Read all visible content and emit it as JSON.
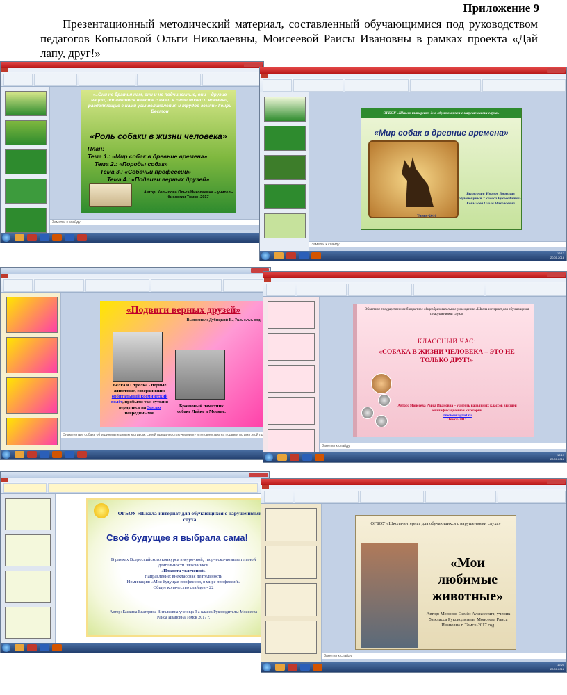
{
  "document": {
    "appendix": "Приложение 9",
    "intro": "Презентационный методический материал, составленный обучающимися под руководством педагогов Копыловой Ольги Николаевны, Моисеевой Раисы Ивановны в рамках проекта «Дай лапу, друг!»"
  },
  "screenshots": {
    "notes_label": "Заметки к слайду",
    "s1": {
      "epigraph": "«..Они не братья нам, они и не подчиненные, они – другие нации, попавшиеся вместе с нами в сети жизни и времени, разделяющие с нами узы великолепия и трудов земли» Генри Бестон",
      "title": "«Роль собаки в жизни человека»",
      "plan": [
        "План:",
        "Тема 1.: «Мир собак в древние времена»",
        "Тема 2.: «Породы собак»",
        "Тема 3.: «Собачьи профессии»",
        "Тема 4.: «Подвиги верных друзей»"
      ],
      "author": "Автор: Копылова Ольга Николаевна – учитель биологии Томск -2017"
    },
    "s2": {
      "org": "ОГБОУ «Школа-интернат для обучающихся с нарушениями слуха»",
      "title": "«Мир собак в древние времена»",
      "info": "Выполнил: Иванов Вячеслав обучающийся 7 класса Руководитель: Копылова Ольга Николаевна",
      "city": "Томск-2016"
    },
    "s3": {
      "title": "«Подвиги верных друзей»",
      "byline": "Выполнил: Дубицкий В., 7кл. о.ч.з. отд.",
      "caption1_a": "Белка и Стрелка - первые животные, совершившие",
      "caption1_link": "орбитальный космический полёт",
      "caption1_b": ", пробыли там сутки и вернулись на",
      "caption1_link2": "Землю",
      "caption1_c": "невредимыми.",
      "caption2": "Бронзовый памятник собаке Лайке в Москве.",
      "notes": "Знаменитые собаки объединены единым мотивом: своей преданностью человеку и готовностью на подвиги во имя этой преданности"
    },
    "s4": {
      "org": "Областное государственное бюджетное общеобразовательное учреждение «Школа-интернат для обучающихся с нарушениями слуха»",
      "subtitle": "КЛАССНЫЙ ЧАС:",
      "title": "«СОБАКА В ЖИЗНИ ЧЕЛОВЕКА – ЭТО НЕ ТОЛЬКО ДРУГ!»",
      "author": "Автор: Моисеева Раиса Ивановна – учитель начальных классов высшей квалификационной категории",
      "email": "rlmoiseeva@list.ru",
      "city": "Томск-2017"
    },
    "s5": {
      "org": "ОГБОУ «Школа-интернат для обучающихся с нарушениями слуха",
      "title": "Своё будущее я выбрала сама!",
      "line1": "В рамках Всероссийского конкурса внеурочной, творческо-познавательной деятельности школьников",
      "line2": "«Планета увлечений»",
      "line3": "Направление: внеклассная деятельность",
      "line4": "Номинация: «Моя будущая профессия, в мире профессий»",
      "line5": "Общее количество слайдов - 22",
      "author": "Автор: Баскина Екатерина Витальевна ученица 9 а класса Руководитель: Моисеева Раиса Ивановна Томск 2017 г."
    },
    "s6": {
      "org": "ОГБОУ «Школа-интернат для обучающихся с нарушениями слуха»",
      "title": "«Мои любимые животные»",
      "author": "Автор: Морозов Семён Алексеевич, ученик 5а класса Руководитель: Моисеева Раиса Ивановна г. Томск-2017 год."
    }
  }
}
